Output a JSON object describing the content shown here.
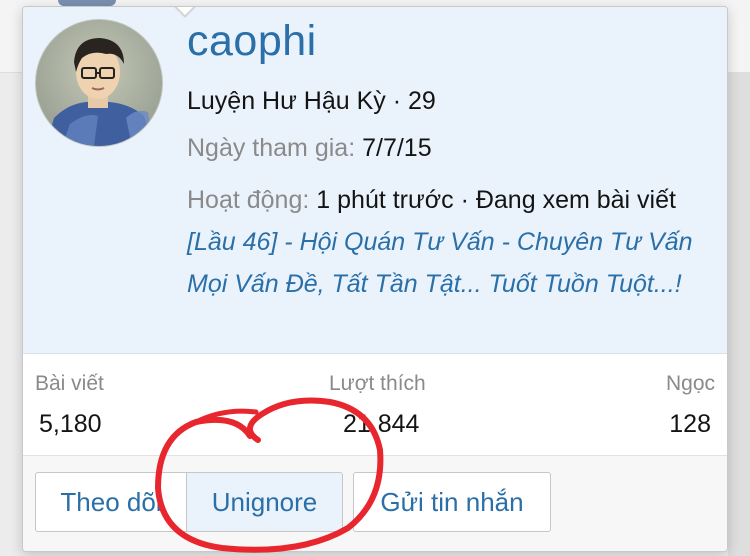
{
  "profile": {
    "username": "caophi",
    "rank": "Luyện Hư Hậu Kỳ · 29",
    "joined_label": "Ngày tham gia:",
    "joined_value": "7/7/15",
    "activity_label": "Hoạt động:",
    "activity_text": "1 phút trước · Đang xem bài viết",
    "activity_link": "[Lầu 46] - Hội Quán Tư Vấn - Chuyên Tư Vấn Mọi Vấn Đề, Tất Tần Tật... Tuốt Tuồn Tuột...!"
  },
  "stats": {
    "posts_label": "Bài viết",
    "posts_value": "5,180",
    "likes_label": "Lượt thích",
    "likes_value": "21,844",
    "gems_label": "Ngọc",
    "gems_value": "128"
  },
  "actions": {
    "follow": "Theo dõi",
    "unignore": "Unignore",
    "message": "Gửi tin nhắn"
  },
  "colors": {
    "accent": "#2a6fa8",
    "profile_bg": "#eaf3fc",
    "annotation": "#e8262e"
  }
}
